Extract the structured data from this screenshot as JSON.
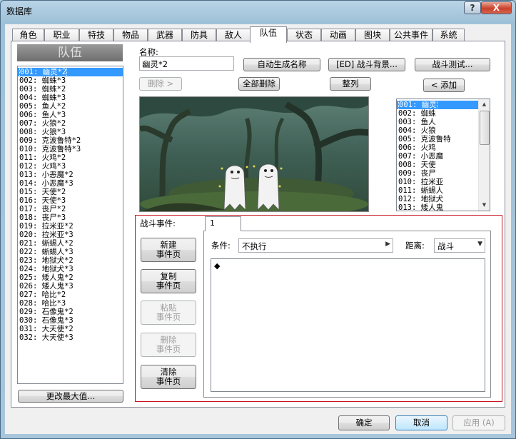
{
  "window": {
    "title": "数据库"
  },
  "titlebar": {
    "help_label": "?",
    "close_label": "X"
  },
  "tabs": [
    "角色",
    "职业",
    "特技",
    "物品",
    "武器",
    "防具",
    "敌人",
    "队伍",
    "状态",
    "动画",
    "图块",
    "公共事件",
    "系统"
  ],
  "active_tab": "队伍",
  "left_panel": {
    "header": "队伍",
    "items": [
      "001: 幽灵*2",
      "002: 蜘蛛*3",
      "003: 蜘蛛*2",
      "004: 蜘蛛*3",
      "005: 鱼人*2",
      "006: 鱼人*3",
      "007: 火狼*2",
      "008: 火狼*3",
      "009: 克波鲁特*2",
      "010: 克波鲁特*3",
      "011: 火鸡*2",
      "012: 火鸡*3",
      "013: 小恶魔*2",
      "014: 小恶魔*3",
      "015: 天使*2",
      "016: 天使*3",
      "017: 丧尸*2",
      "018: 丧尸*3",
      "019: 拉米亚*2",
      "020: 拉米亚*3",
      "021: 蜥蜴人*2",
      "022: 蜥蜴人*3",
      "023: 地狱犬*2",
      "024: 地狱犬*3",
      "025: 矮人鬼*2",
      "026: 矮人鬼*3",
      "027: 哈比*2",
      "028: 哈比*3",
      "029: 石像鬼*2",
      "030: 石像鬼*3",
      "031: 大天使*2",
      "032: 大天使*3"
    ],
    "selected_index": 0,
    "change_max_label": "更改最大值..."
  },
  "troop": {
    "name_label": "名称:",
    "name_value": "幽灵*2",
    "autoname_label": "自动生成名称",
    "battleback_label": "[ED] 战斗背景...",
    "battletest_label": "战斗测试...",
    "remove_label": "删除 >",
    "clear_label": "全部删除",
    "arrange_label": "整列",
    "add_label": "< 添加"
  },
  "enemy_list": {
    "items": [
      "001: 幽灵",
      "002: 蜘蛛",
      "003: 鱼人",
      "004: 火狼",
      "005: 克波鲁特",
      "006: 火鸡",
      "007: 小恶魔",
      "008: 天使",
      "009: 丧尸",
      "010: 拉米亚",
      "011: 蜥蜴人",
      "012: 地狱犬",
      "013: 矮人鬼"
    ],
    "selected_index": 0
  },
  "battle_event": {
    "label": "战斗事件:",
    "page_tab": "1",
    "new_page": [
      "新建",
      "事件页"
    ],
    "copy_page": [
      "复制",
      "事件页"
    ],
    "paste_page": [
      "粘贴",
      "事件页"
    ],
    "delete_page": [
      "删除",
      "事件页"
    ],
    "clear_page": [
      "清除",
      "事件页"
    ],
    "condition_label": "条件:",
    "condition_value": "不执行",
    "span_label": "距离:",
    "span_value": "战斗",
    "command_marker": "◆"
  },
  "footer": {
    "ok_label": "确定",
    "cancel_label": "取消",
    "apply_label": "应用 (A)"
  }
}
